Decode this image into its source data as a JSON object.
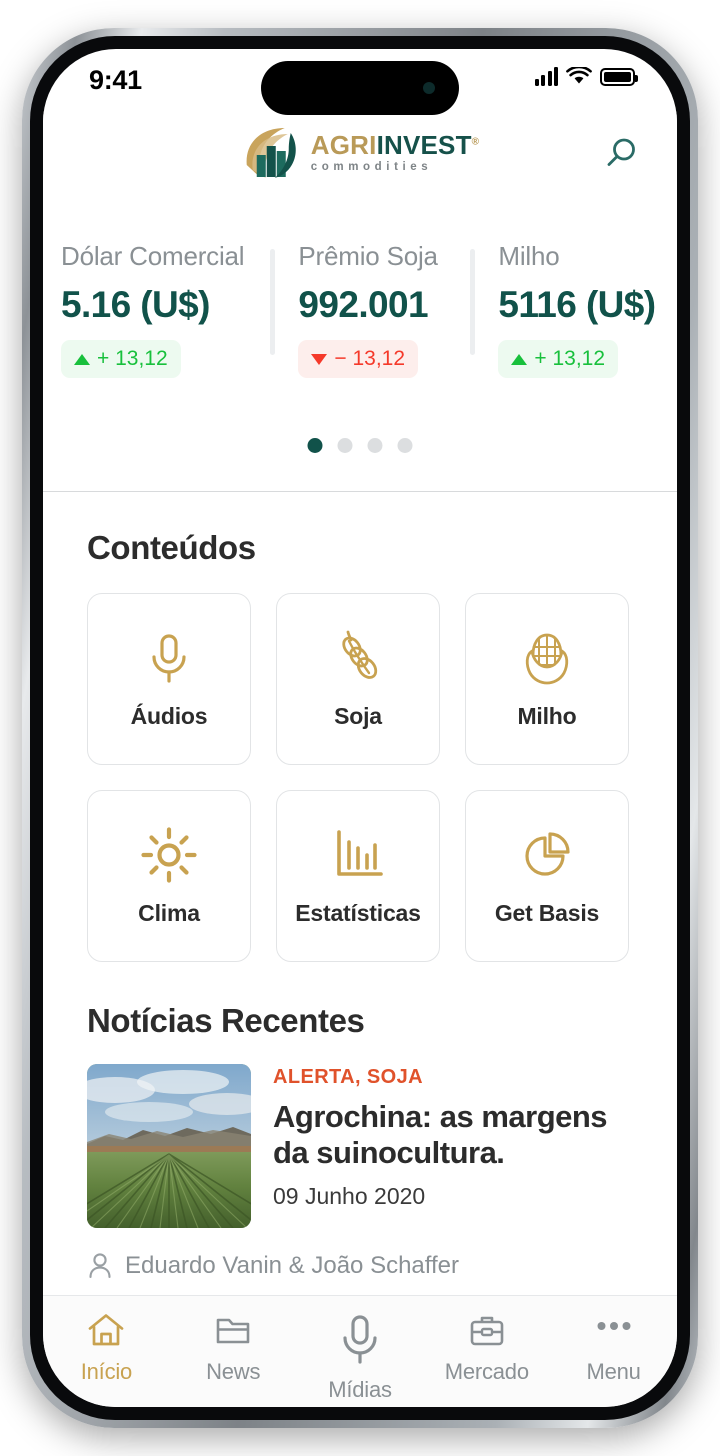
{
  "status_bar": {
    "time": "9:41",
    "signal_icon": "cellular-signal-icon",
    "wifi_icon": "wifi-icon",
    "battery_icon": "battery-icon"
  },
  "header": {
    "logo_mark": "agrinvest-logo-mark",
    "logo_name_part1": "AGRI",
    "logo_name_part2": "INVEST",
    "logo_registered": "®",
    "logo_subtitle": "commodities",
    "search_icon": "search-icon"
  },
  "ticker": {
    "items": [
      {
        "label": "Dólar Comercial",
        "value": "5.16 (U$)",
        "change": "+ 13,12",
        "direction": "up",
        "arrow_icon": "triangle-up-icon"
      },
      {
        "label": "Prêmio Soja",
        "value": "992.001",
        "change": "− 13,12",
        "direction": "down",
        "arrow_icon": "triangle-down-icon"
      },
      {
        "label": "Milho",
        "value": "5116 (U$)",
        "change": "+ 13,12",
        "direction": "up",
        "arrow_icon": "triangle-up-icon"
      }
    ],
    "pager": {
      "total": 4,
      "active_index": 0
    }
  },
  "content": {
    "section_title": "Conteúdos",
    "tiles": [
      {
        "label": "Áudios",
        "icon": "microphone-icon"
      },
      {
        "label": "Soja",
        "icon": "soybean-pod-icon"
      },
      {
        "label": "Milho",
        "icon": "corn-cob-icon"
      },
      {
        "label": "Clima",
        "icon": "sun-icon"
      },
      {
        "label": "Estatísticas",
        "icon": "bar-chart-icon"
      },
      {
        "label": "Get Basis",
        "icon": "pie-chart-icon"
      }
    ]
  },
  "news": {
    "section_title": "Notícias Recentes",
    "items": [
      {
        "tag": "ALERTA, SOJA",
        "title": "Agrochina: as margens da suinocultura.",
        "date": "09 Junho 2020",
        "author": "Eduardo Vanin & João Schaffer",
        "author_icon": "person-icon",
        "thumbnail": "crop-field-photo"
      }
    ]
  },
  "tab_bar": {
    "items": [
      {
        "label": "Início",
        "icon": "home-icon",
        "active": true
      },
      {
        "label": "News",
        "icon": "folder-icon",
        "active": false
      },
      {
        "label": "Mídias",
        "icon": "microphone-icon",
        "active": false
      },
      {
        "label": "Mercado",
        "icon": "briefcase-icon",
        "active": false
      },
      {
        "label": "Menu",
        "icon": "ellipsis-icon",
        "active": false
      }
    ]
  },
  "colors": {
    "brand_teal": "#11524a",
    "brand_gold": "#c8a250",
    "positive": "#18c03c",
    "negative": "#f5392a",
    "alert_tag": "#e0522b"
  }
}
